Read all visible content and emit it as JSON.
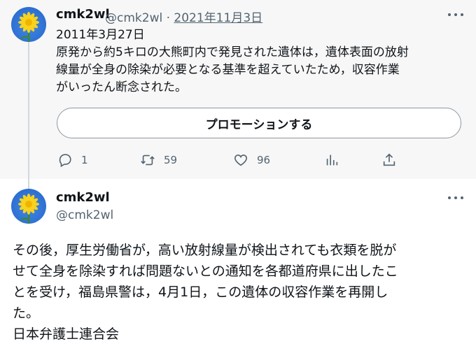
{
  "tweet1": {
    "display_name": "cmk2wl",
    "handle": "@cmk2wl",
    "separator": "·",
    "date": "2021年11月3日",
    "text": "2011年3月27日\n原発から約5キロの大熊町内で発見された遺体は，遺体表面の放射\n線量が全身の除染が必要となる基準を超えていたため，収容作業\nがいったん断念された。",
    "promote_label": "プロモーションする",
    "actions": {
      "reply_count": "1",
      "retweet_count": "59",
      "like_count": "96"
    }
  },
  "tweet2": {
    "display_name": "cmk2wl",
    "handle": "@cmk2wl",
    "text": "その後，厚生労働省が，高い放射線量が検出されても衣類を脱が\nせて全身を除染すれば問題ないとの通知を各都道府県に出したこ\nとを受け，福島県警は，4月1日，この遺体の収容作業を再開し\nた。\n日本弁護士連合会"
  },
  "icons": {
    "reply": "reply-icon",
    "retweet": "retweet-icon",
    "like": "heart-icon",
    "analytics": "analytics-icon",
    "share": "share-icon",
    "more": "more-icon"
  }
}
